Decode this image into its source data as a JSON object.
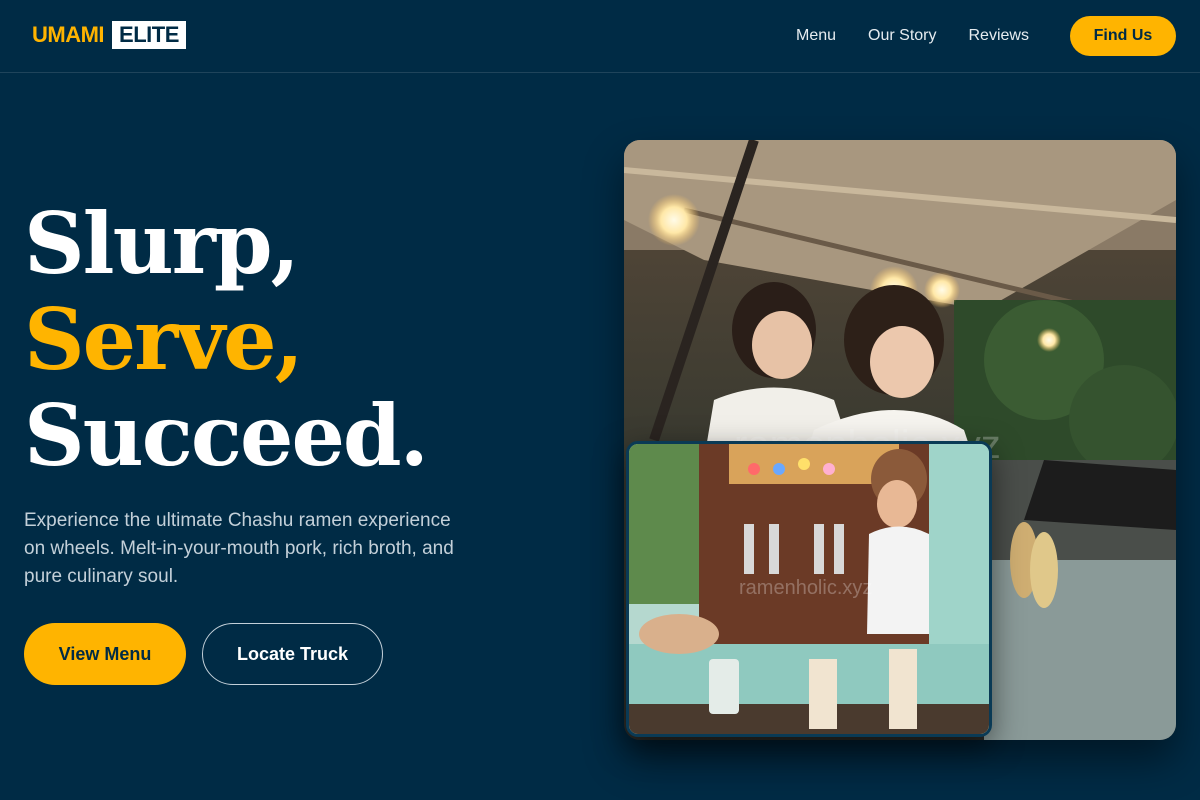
{
  "brand": {
    "part1": "UMAMI",
    "part2": "ELITE"
  },
  "nav": {
    "links": [
      "Menu",
      "Our Story",
      "Reviews"
    ],
    "cta": "Find Us"
  },
  "hero": {
    "headline": [
      "Slurp,",
      "Serve,",
      "Succeed."
    ],
    "subtext": "Experience the ultimate Chashu ramen experience on wheels. Melt-in-your-mouth pork, rich broth, and pure culinary soul.",
    "primary_button": "View Menu",
    "secondary_button": "Locate Truck"
  },
  "images": {
    "main_watermark": "ramenholic.xyz",
    "inset_watermark": "ramenholic.xyz"
  },
  "colors": {
    "background": "#002b45",
    "accent": "#ffb400",
    "text": "#ffffff",
    "muted": "#c3d0d9"
  }
}
